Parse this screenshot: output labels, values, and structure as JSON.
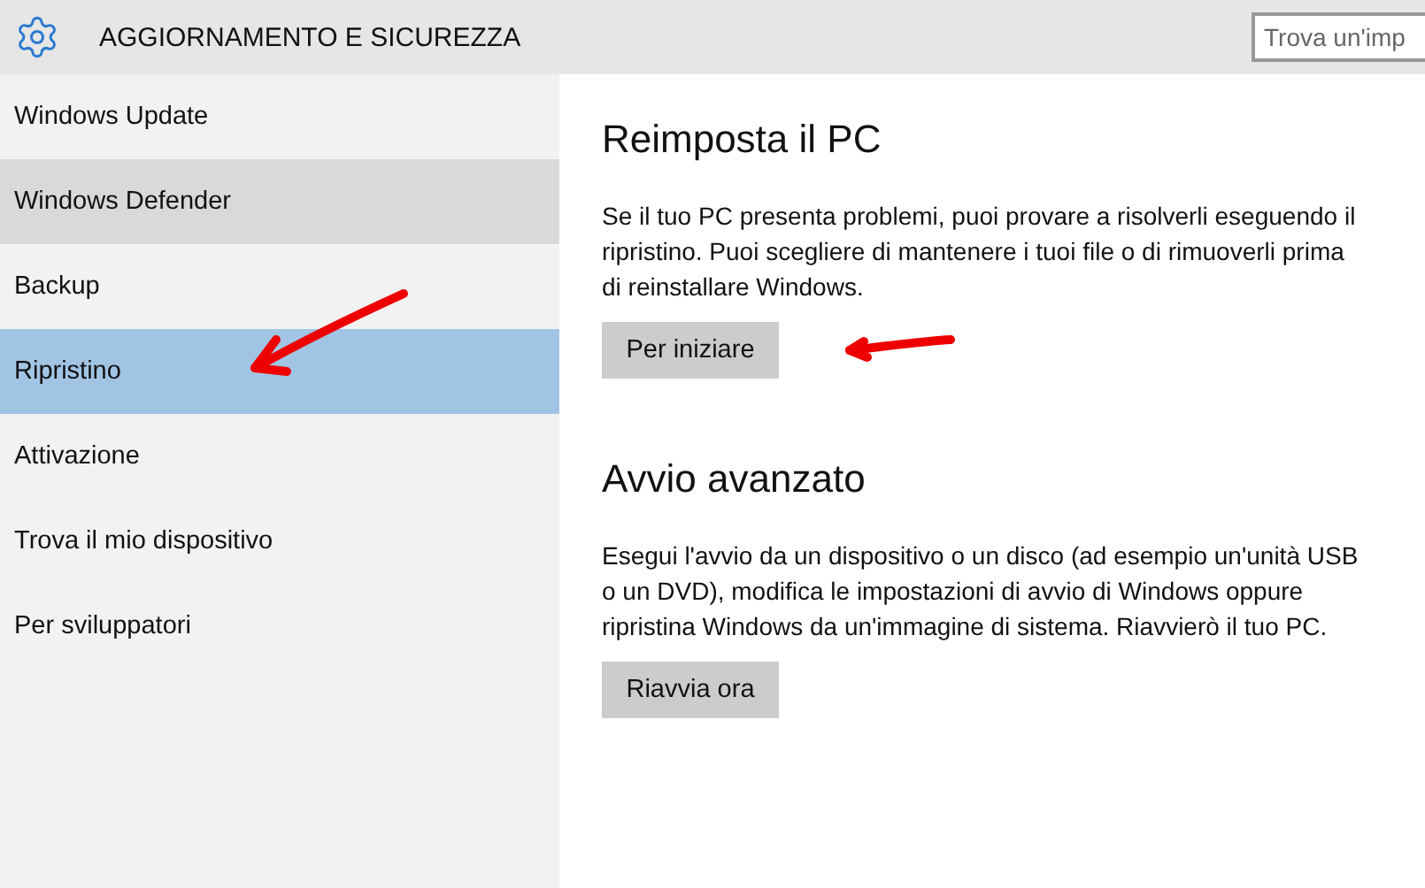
{
  "header": {
    "title": "AGGIORNAMENTO E SICUREZZA",
    "search": {
      "placeholder": "Trova un'imp"
    }
  },
  "sidebar": {
    "items": [
      {
        "label": "Windows Update",
        "selected": false,
        "hovered": false
      },
      {
        "label": "Windows Defender",
        "selected": false,
        "hovered": true
      },
      {
        "label": "Backup",
        "selected": false,
        "hovered": false
      },
      {
        "label": "Ripristino",
        "selected": true,
        "hovered": false
      },
      {
        "label": "Attivazione",
        "selected": false,
        "hovered": false
      },
      {
        "label": "Trova il mio dispositivo",
        "selected": false,
        "hovered": false
      },
      {
        "label": "Per sviluppatori",
        "selected": false,
        "hovered": false
      }
    ]
  },
  "sections": [
    {
      "heading": "Reimposta il PC",
      "text": "Se il tuo PC presenta problemi, puoi provare a risolverli eseguendo il ripristino. Puoi scegliere di mantenere i tuoi file o di rimuoverli prima di reinstallare Windows.",
      "button": "Per iniziare"
    },
    {
      "heading": "Avvio avanzato",
      "text": "Esegui l'avvio da un dispositivo o un disco (ad esempio un'unità USB o un DVD), modifica le impostazioni di avvio di Windows oppure ripristina Windows da un'immagine di sistema. Riavvierò il tuo PC.",
      "button": "Riavvia ora"
    }
  ]
}
